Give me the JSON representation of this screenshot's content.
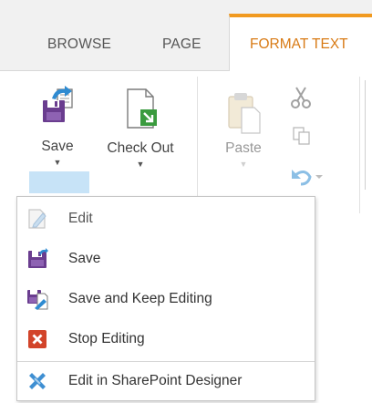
{
  "tabs": [
    {
      "label": "BROWSE"
    },
    {
      "label": "PAGE"
    },
    {
      "label": "FORMAT TEXT",
      "active": true
    }
  ],
  "ribbon": {
    "save_label": "Save",
    "checkout_label": "Check Out",
    "paste_label": "Paste",
    "dropdown_arrow": "▼"
  },
  "menu": {
    "items": [
      {
        "label": "Edit",
        "icon": "edit-icon",
        "enabled": false
      },
      {
        "label": "Save",
        "icon": "save-icon",
        "enabled": true
      },
      {
        "label": "Save and Keep Editing",
        "icon": "save-keep-editing-icon",
        "enabled": true
      },
      {
        "label": "Stop Editing",
        "icon": "stop-editing-icon",
        "enabled": true
      },
      {
        "label": "Edit in SharePoint Designer",
        "icon": "sharepoint-designer-icon",
        "enabled": true
      }
    ]
  },
  "colors": {
    "accent_orange": "#f19a20",
    "tab_active_text": "#d87a14",
    "save_purple": "#6a3d8f",
    "stop_red": "#d2442a",
    "checkout_green": "#3a9b3e",
    "highlight_blue": "#c7e3f7"
  }
}
